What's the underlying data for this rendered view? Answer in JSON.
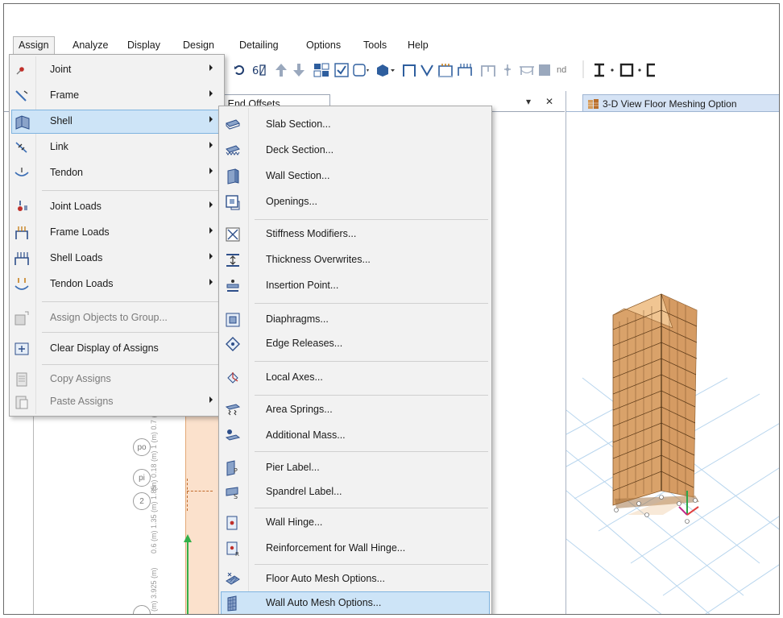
{
  "menubar": {
    "items": [
      "Assign",
      "Analyze",
      "Display",
      "Design",
      "Detailing",
      "Options",
      "Tools",
      "Help"
    ]
  },
  "toolbar": {
    "nd_text": "nd"
  },
  "left_pane": {
    "tab_title": ") End Offsets",
    "ctrl_dropdown": "▾",
    "ctrl_close": "✕",
    "bubbles": [
      "po",
      "pi",
      "2"
    ],
    "dim_texts": [
      "(m) 3.925 (m)",
      "0.6 (m) 1.35 (m) 1.85",
      "(m) 0.18 (m) 1 (m) 0.7 (m) 0.7748 (m)"
    ]
  },
  "right_pane": {
    "tab_title": "3-D View  Floor Meshing Option"
  },
  "assign_menu": {
    "items": [
      {
        "label": "Joint",
        "icon": "joint-icon",
        "submenu": true
      },
      {
        "label": "Frame",
        "icon": "frame-icon",
        "submenu": true
      },
      {
        "label": "Shell",
        "icon": "shell-icon",
        "submenu": true,
        "selected": true
      },
      {
        "label": "Link",
        "icon": "link-icon",
        "submenu": true
      },
      {
        "label": "Tendon",
        "icon": "tendon-icon",
        "submenu": true
      },
      {
        "label": "Joint Loads",
        "icon": "joint-loads-icon",
        "submenu": true
      },
      {
        "label": "Frame Loads",
        "icon": "frame-loads-icon",
        "submenu": true
      },
      {
        "label": "Shell Loads",
        "icon": "shell-loads-icon",
        "submenu": true
      },
      {
        "label": "Tendon Loads",
        "icon": "tendon-loads-icon",
        "submenu": true
      },
      {
        "label": "Assign Objects to Group...",
        "icon": "group-icon",
        "disabled": true
      },
      {
        "label": "Clear Display of Assigns",
        "icon": "clear-display-icon"
      },
      {
        "label": "Copy Assigns",
        "icon": "copy-assigns-icon",
        "disabled": true
      },
      {
        "label": "Paste Assigns",
        "icon": "paste-assigns-icon",
        "disabled": true,
        "submenu": true
      }
    ]
  },
  "shell_submenu": {
    "items": [
      {
        "label": "Slab Section...",
        "icon": "slab-section-icon"
      },
      {
        "label": "Deck Section...",
        "icon": "deck-section-icon"
      },
      {
        "label": "Wall Section...",
        "icon": "wall-section-icon"
      },
      {
        "label": "Openings...",
        "icon": "openings-icon"
      },
      {
        "label": "Stiffness Modifiers...",
        "icon": "stiffness-modifiers-icon"
      },
      {
        "label": "Thickness Overwrites...",
        "icon": "thickness-overwrites-icon"
      },
      {
        "label": "Insertion Point...",
        "icon": "insertion-point-icon"
      },
      {
        "label": "Diaphragms...",
        "icon": "diaphragms-icon"
      },
      {
        "label": "Edge Releases...",
        "icon": "edge-releases-icon"
      },
      {
        "label": "Local Axes...",
        "icon": "local-axes-icon"
      },
      {
        "label": "Area Springs...",
        "icon": "area-springs-icon"
      },
      {
        "label": "Additional Mass...",
        "icon": "additional-mass-icon"
      },
      {
        "label": "Pier Label...",
        "icon": "pier-label-icon"
      },
      {
        "label": "Spandrel Label...",
        "icon": "spandrel-label-icon"
      },
      {
        "label": "Wall Hinge...",
        "icon": "wall-hinge-icon"
      },
      {
        "label": "Reinforcement for Wall Hinge...",
        "icon": "reinforcement-wall-hinge-icon"
      },
      {
        "label": "Floor Auto Mesh Options...",
        "icon": "floor-auto-mesh-icon"
      },
      {
        "label": "Wall Auto Mesh Options...",
        "icon": "wall-auto-mesh-icon",
        "selected": true
      }
    ]
  },
  "colors": {
    "menu_bg": "#f2f2f2",
    "selected_bg": "#cde4f7",
    "selected_border": "#7fb4e0",
    "plan_band": "#fbe1cc",
    "building": "#e8b57f"
  }
}
